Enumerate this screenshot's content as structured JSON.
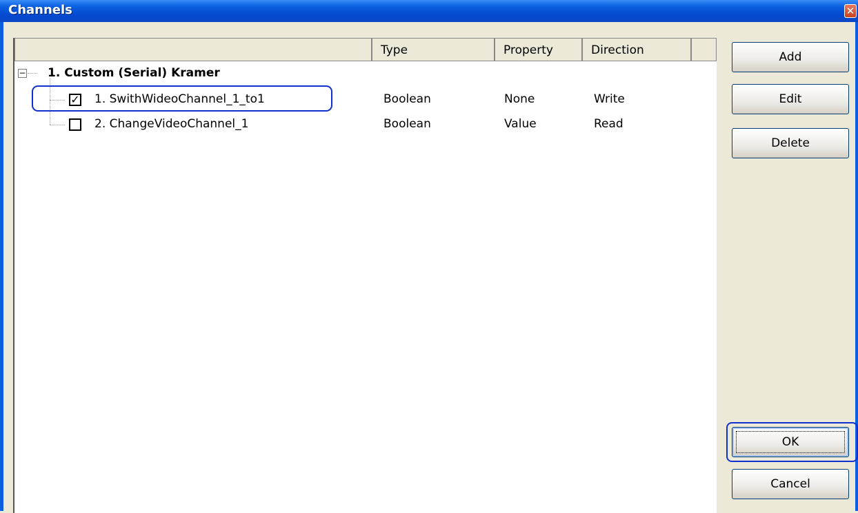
{
  "window": {
    "title": "Channels",
    "close_glyph": "✕"
  },
  "columns": [
    "",
    "Type",
    "Property",
    "Direction"
  ],
  "tree": {
    "group_label": "1. Custom (Serial) Kramer",
    "expander_glyph": "−",
    "rows": [
      {
        "checked": true,
        "label": "1. SwithWideoChannel_1_to1",
        "type": "Boolean",
        "property": "None",
        "direction": "Write",
        "check_glyph": "✓"
      },
      {
        "checked": false,
        "label": "2. ChangeVideoChannel_1",
        "type": "Boolean",
        "property": "Value",
        "direction": "Read",
        "check_glyph": ""
      }
    ]
  },
  "buttons": {
    "add": "Add",
    "edit": "Edit",
    "delete": "Delete",
    "ok": "OK",
    "cancel": "Cancel"
  },
  "colors": {
    "title_bar": "#0A5FE0",
    "window_bg": "#ECE9D8",
    "highlight": "#1030D0"
  }
}
